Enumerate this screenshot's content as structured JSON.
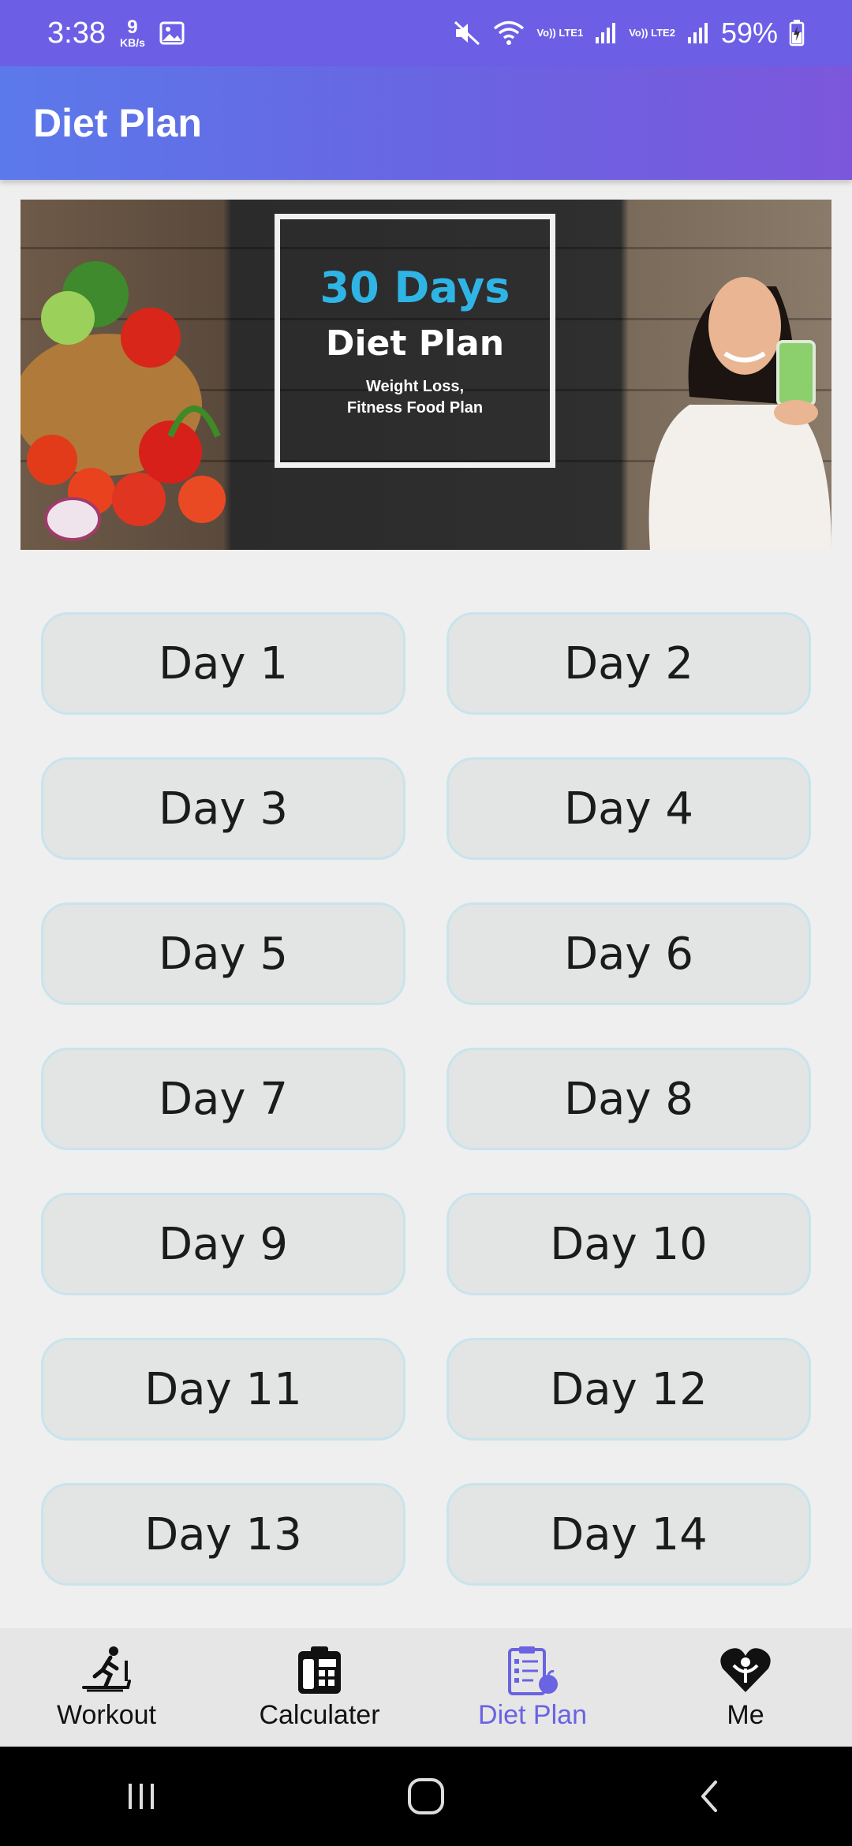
{
  "status_bar": {
    "time": "3:38",
    "net_speed_value": "9",
    "net_speed_unit": "KB/s",
    "sim1": "Vo)) LTE1",
    "sim2": "Vo)) LTE2",
    "battery": "59%"
  },
  "app_bar": {
    "title": "Diet Plan"
  },
  "banner": {
    "headline": "30 Days",
    "title": "Diet Plan",
    "subtitle_line1": "Weight Loss,",
    "subtitle_line2": "Fitness Food Plan"
  },
  "days": [
    {
      "label": "Day 1"
    },
    {
      "label": "Day 2"
    },
    {
      "label": "Day 3"
    },
    {
      "label": "Day 4"
    },
    {
      "label": "Day 5"
    },
    {
      "label": "Day 6"
    },
    {
      "label": "Day 7"
    },
    {
      "label": "Day 8"
    },
    {
      "label": "Day 9"
    },
    {
      "label": "Day 10"
    },
    {
      "label": "Day 11"
    },
    {
      "label": "Day 12"
    },
    {
      "label": "Day 13"
    },
    {
      "label": "Day 14"
    }
  ],
  "bottom_nav": {
    "items": [
      {
        "label": "Workout",
        "icon": "treadmill-icon"
      },
      {
        "label": "Calculater",
        "icon": "calculator-icon"
      },
      {
        "label": "Diet Plan",
        "icon": "diet-clipboard-icon",
        "active": true
      },
      {
        "label": "Me",
        "icon": "heart-person-icon"
      }
    ]
  },
  "colors": {
    "accent": "#6a63e2",
    "status_bar": "#6c5fe6",
    "button_bg": "#e3e4e4",
    "button_border": "#c8e4ec"
  }
}
